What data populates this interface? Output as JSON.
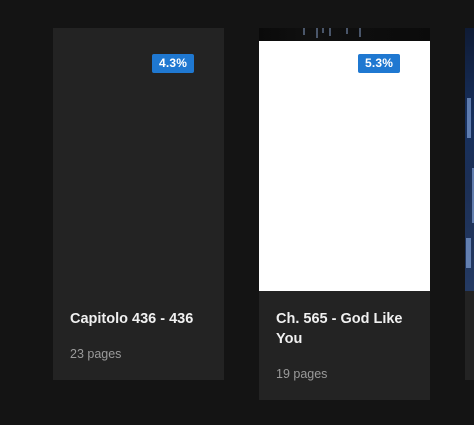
{
  "chapters": [
    {
      "progress_label": "4.3%",
      "progress_percent": 4.3,
      "title": "Capitolo 436 - 436",
      "pages_label": "23 pages"
    },
    {
      "progress_label": "5.3%",
      "progress_percent": 5.3,
      "title": "Ch. 565 - God Like You",
      "pages_label": "19 pages"
    }
  ],
  "colors": {
    "background": "#141414",
    "card": "#232323",
    "badge": "#1f78d1",
    "title": "#f0f0f0",
    "meta": "#9a9a9a"
  }
}
